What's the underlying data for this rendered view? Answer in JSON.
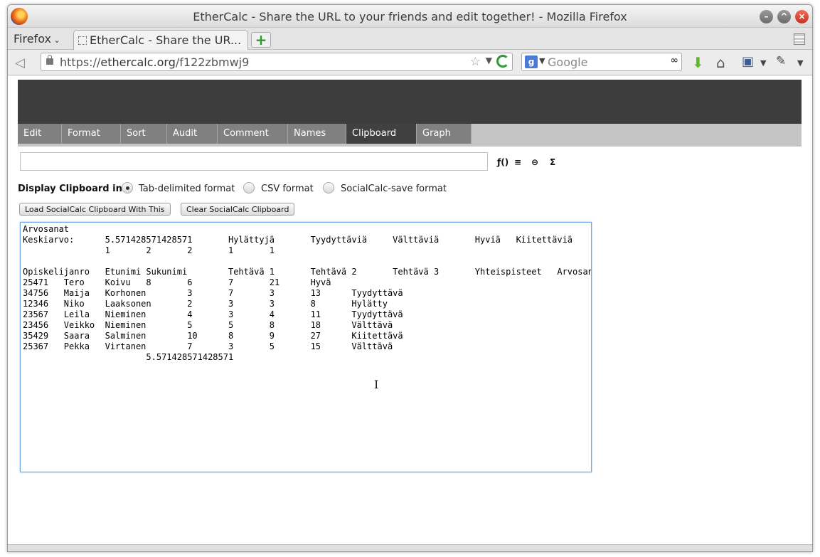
{
  "window": {
    "title": "EtherCalc - Share the URL to your friends and edit together! - Mozilla Firefox",
    "controls": {
      "minimize": "–",
      "maximize": "^",
      "close": "×"
    }
  },
  "browser": {
    "menu_label": "Firefox",
    "tab_title": "EtherCalc - Share the UR...",
    "new_tab": "+",
    "url_scheme": "https://",
    "url_host": "ethercalc.org",
    "url_path": "/f122zbmwj9",
    "search_placeholder": "Google",
    "search_engine_letter": "g"
  },
  "ethercalc": {
    "tabs": [
      {
        "label": "Edit"
      },
      {
        "label": "Format"
      },
      {
        "label": "Sort"
      },
      {
        "label": "Audit"
      },
      {
        "label": "Comment"
      },
      {
        "label": "Names"
      },
      {
        "label": "Clipboard",
        "active": true
      },
      {
        "label": "Graph"
      }
    ],
    "formula_buttons": [
      "ƒ()",
      "≡",
      "⊖",
      "Σ"
    ],
    "clipboard": {
      "display_label": "Display Clipboard in:",
      "formats": [
        {
          "label": "Tab-delimited format",
          "selected": true
        },
        {
          "label": "CSV format",
          "selected": false
        },
        {
          "label": "SocialCalc-save format",
          "selected": false
        }
      ],
      "load_button": "Load SocialCalc Clipboard With This",
      "clear_button": "Clear SocialCalc Clipboard",
      "content": "Arvosanat\nKeskiarvo:\t5.571428571428571\tHylättyjä\tTyydyttäviä\tVälttäviä\tHyviä\tKiitettäviä\n\t\t1\t2\t2\t1\t1\n\nOpiskelijanro\tEtunimi\tSukunimi\tTehtävä 1\tTehtävä 2\tTehtävä 3\tYhteispisteet\tArvosana\n25471\tTero\tKoivu\t8\t6\t7\t21\tHyvä\n34756\tMaija\tKorhonen\t3\t7\t3\t13\tTyydyttävä\n12346\tNiko\tLaaksonen\t2\t3\t3\t8\tHylätty\n23567\tLeila\tNieminen\t4\t3\t4\t11\tTyydyttävä\n23456\tVeikko\tNieminen\t5\t5\t8\t18\tVälttävä\n35429\tSaara\tSalminen\t10\t8\t9\t27\tKiitettävä\n25367\tPekka\tVirtanen\t7\t3\t5\t15\tVälttävä\n\t\t\t5.571428571428571"
    }
  },
  "icons": [
    "firefox-logo-icon",
    "back-arrow-icon",
    "lock-icon",
    "bookmark-star-icon",
    "reload-icon",
    "binoculars-icon",
    "download-arrow-icon",
    "home-icon",
    "bookmarks-icon",
    "eyedropper-icon",
    "text-cursor-icon"
  ]
}
